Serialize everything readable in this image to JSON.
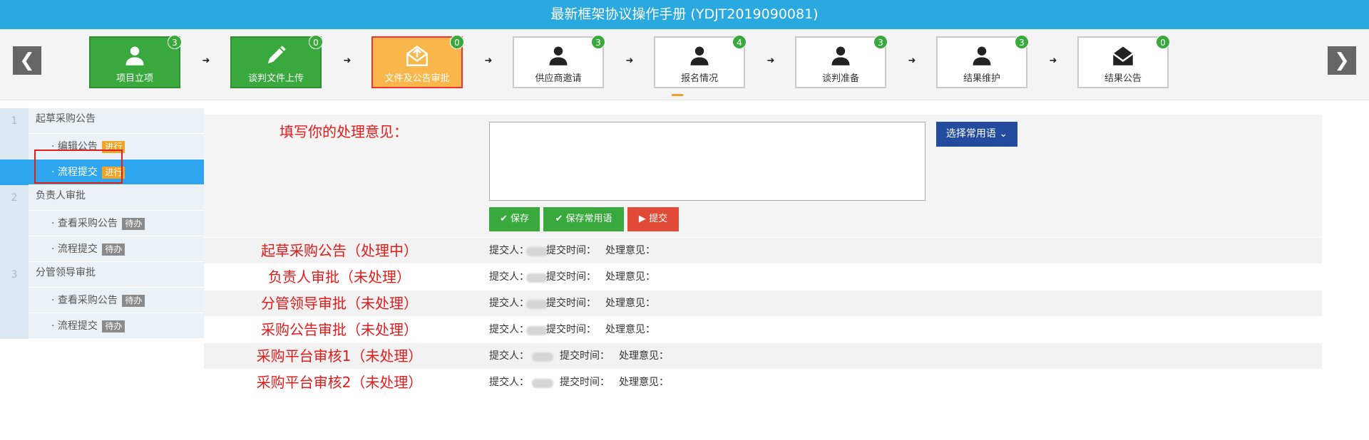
{
  "window": {
    "title": "最新框架协议操作手册 (YDJT2019090081)"
  },
  "nav": {
    "prev_symbol": "❮",
    "next_symbol": "❯"
  },
  "steps": [
    {
      "label": "项目立项",
      "count": "3",
      "state": "done",
      "icon": "user-icon"
    },
    {
      "label": "谈判文件上传",
      "count": "0",
      "state": "done",
      "icon": "pencil-icon"
    },
    {
      "label": "文件及公告审批",
      "count": "0",
      "state": "current",
      "icon": "mail-upload-icon"
    },
    {
      "label": "供应商邀请",
      "count": "3",
      "state": "pending",
      "icon": "user-icon"
    },
    {
      "label": "报名情况",
      "count": "4",
      "state": "pending",
      "icon": "user-icon"
    },
    {
      "label": "谈判准备",
      "count": "3",
      "state": "pending",
      "icon": "user-icon"
    },
    {
      "label": "结果维护",
      "count": "3",
      "state": "pending",
      "icon": "user-icon"
    },
    {
      "label": "结果公告",
      "count": "0",
      "state": "pending",
      "icon": "envelope-icon"
    }
  ],
  "sidebar": {
    "groups": [
      {
        "num": "1",
        "title": "起草采购公告",
        "items": [
          {
            "label": "· 编辑公告",
            "tag": "进行",
            "tag_type": "going"
          },
          {
            "label": "· 流程提交",
            "tag": "进行",
            "tag_type": "going",
            "active": true
          }
        ]
      },
      {
        "num": "2",
        "title": "负责人审批",
        "items": [
          {
            "label": "· 查看采购公告",
            "tag": "待办",
            "tag_type": "todo"
          },
          {
            "label": "· 流程提交",
            "tag": "待办",
            "tag_type": "todo"
          }
        ]
      },
      {
        "num": "3",
        "title": "分管领导审批",
        "items": [
          {
            "label": "· 查看采购公告",
            "tag": "待办",
            "tag_type": "todo"
          },
          {
            "label": "· 流程提交",
            "tag": "待办",
            "tag_type": "todo"
          }
        ]
      }
    ]
  },
  "form": {
    "label": "填写你的处理意见：",
    "opinion_value": "",
    "common_phrases_button": "选择常用语",
    "save_button": "保存",
    "save_common_button": "保存常用语",
    "submit_button": "提交"
  },
  "records": [
    {
      "title": "起草采购公告（处理中）",
      "submitter_label": "提交人：",
      "time_label": "提交时间：",
      "opinion_label": "处理意见："
    },
    {
      "title": "负责人审批（未处理）",
      "submitter_label": "提交人：",
      "time_label": "提交时间：",
      "opinion_label": "处理意见："
    },
    {
      "title": "分管领导审批（未处理）",
      "submitter_label": "提交人：",
      "time_label": "提交时间：",
      "opinion_label": "处理意见："
    },
    {
      "title": "采购公告审批（未处理）",
      "submitter_label": "提交人：",
      "time_label": "提交时间：",
      "opinion_label": "处理意见："
    },
    {
      "title": "采购平台审核1（未处理）",
      "submitter_label": "提交人：",
      "time_label": "提交时间：",
      "opinion_label": "处理意见："
    },
    {
      "title": "采购平台审核2（未处理）",
      "submitter_label": "提交人：",
      "time_label": "提交时间：",
      "opinion_label": "处理意见："
    }
  ],
  "colors": {
    "header": "#2aa9e0",
    "done": "#3aa93d",
    "current": "#f9b74b",
    "active_sidebar": "#2ea6ef",
    "alert_red": "#e31b1b"
  }
}
